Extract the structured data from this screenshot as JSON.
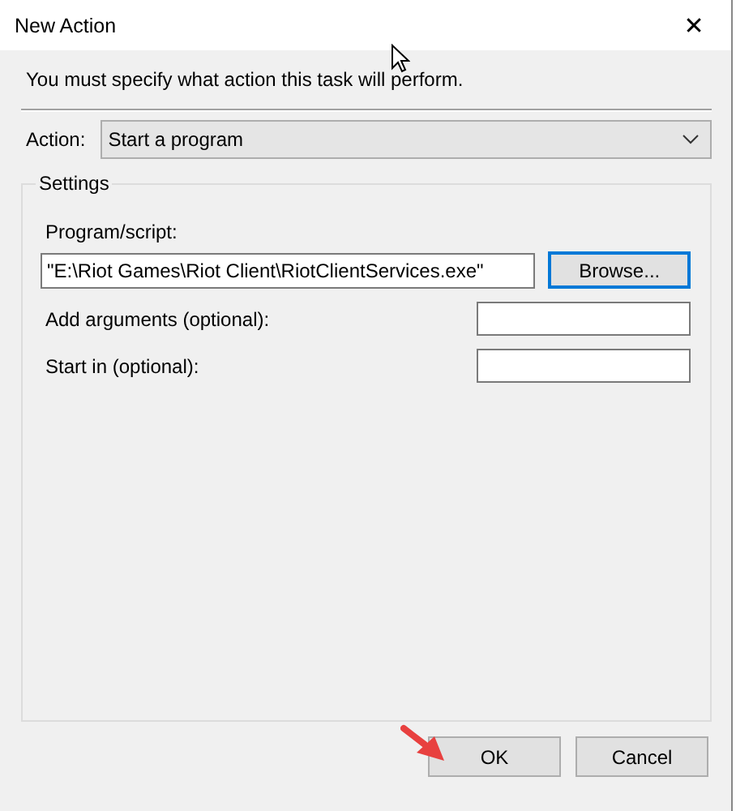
{
  "window": {
    "title": "New Action",
    "close": "✕"
  },
  "instruction": "You must specify what action this task will perform.",
  "action": {
    "label": "Action:",
    "value": "Start a program"
  },
  "settings": {
    "title": "Settings",
    "program": {
      "label": "Program/script:",
      "value": "\"E:\\Riot Games\\Riot Client\\RiotClientServices.exe\"",
      "button": {
        "label": "Browse...",
        "focused": true
      }
    },
    "fields": [
      {
        "label": "Add arguments (optional):"
      },
      {
        "label": "Start in (optional):"
      }
    ]
  },
  "buttons": [
    {
      "label": "OK",
      "focused": false
    },
    {
      "label": "Cancel",
      "focused": false
    }
  ]
}
